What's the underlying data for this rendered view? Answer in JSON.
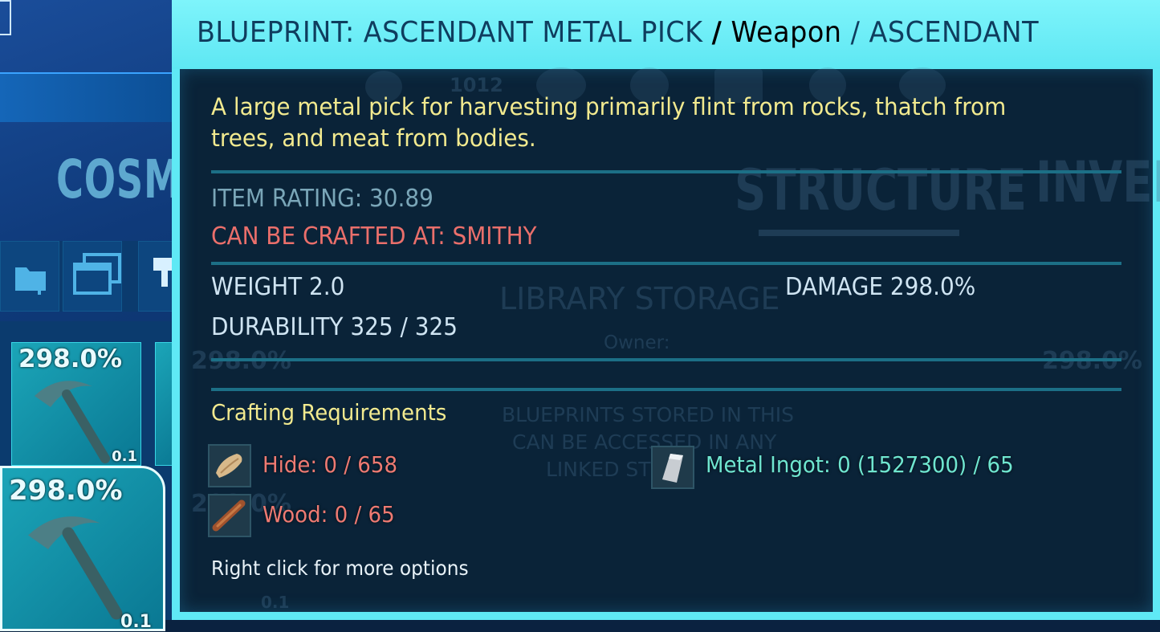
{
  "tooltip": {
    "item_name": "BLUEPRINT: ASCENDANT METAL PICK",
    "separator": "/",
    "category": "Weapon",
    "quality": "ASCENDANT",
    "description": "A large metal pick for harvesting primarily flint from rocks, thatch from trees, and meat from bodies.",
    "item_rating": "ITEM RATING: 30.89",
    "crafted_at": "CAN BE CRAFTED AT: SMITHY",
    "weight": "WEIGHT 2.0",
    "damage": "DAMAGE 298.0%",
    "durability": "DURABILITY 325 / 325",
    "requirements_title": "Crafting Requirements",
    "requirements": [
      {
        "name": "Hide: 0 / 658",
        "icon": "hide-icon",
        "status": "insufficient"
      },
      {
        "name": "Wood: 0 / 65",
        "icon": "wood-icon",
        "status": "insufficient"
      },
      {
        "name": "Metal Ingot: 0 (1527300) / 65",
        "icon": "metal-ingot-icon",
        "status": "available"
      }
    ],
    "hint": "Right click for more options"
  },
  "background": {
    "section_label": "COSM",
    "slot_top_pct": "298.0%",
    "slot_top_weight": "0.1",
    "slot_sel_pct": "298.0%",
    "slot_sel_weight": "0.1",
    "ghost_count": "1012",
    "ghost_structure": "STRUCTURE",
    "ghost_inventory": "INVEN",
    "ghost_library": "LIBRARY STORAGE",
    "ghost_owner": "Owner:",
    "ghost_blueprints_1": "BLUEPRINTS STORED IN THIS",
    "ghost_blueprints_2": "CAN BE ACCESSED IN ANY",
    "ghost_blueprints_3": "LINKED ST",
    "ghost_pct_right": "298.0%",
    "ghost_pct_mid": "298.0%",
    "ghost_pct_low": "298.0%",
    "ghost_weight_low": "0.1"
  },
  "colors": {
    "tooltip_border": "#5fe9f5",
    "description": "#f2ea8f",
    "insufficient": "#ee7a72",
    "available": "#6fe6d0",
    "crafted_at": "#ea6f6b"
  }
}
